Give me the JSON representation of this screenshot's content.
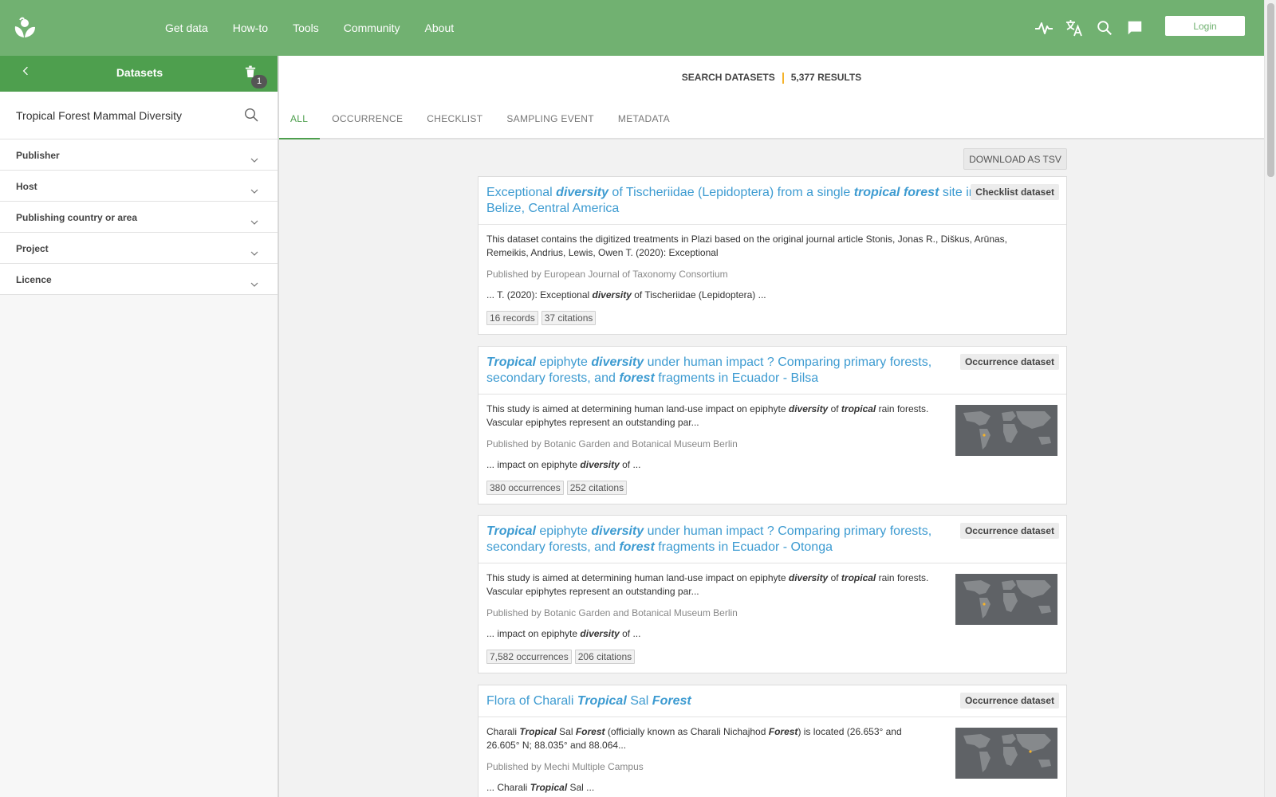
{
  "nav": {
    "items": [
      "Get data",
      "How-to",
      "Tools",
      "Community",
      "About"
    ],
    "login": "Login",
    "icons": [
      "activity-icon",
      "translate-icon",
      "search-icon",
      "feedback-icon"
    ]
  },
  "sidebar": {
    "title": "Datasets",
    "filter_count": "1",
    "search_value": "Tropical Forest Mammal Diversity",
    "facets": [
      "Publisher",
      "Host",
      "Publishing country or area",
      "Project",
      "Licence"
    ]
  },
  "summary": {
    "label": "SEARCH DATASETS",
    "results": "5,377 RESULTS"
  },
  "tabs": [
    "ALL",
    "OCCURRENCE",
    "CHECKLIST",
    "SAMPLING EVENT",
    "METADATA"
  ],
  "download_label": "DOWNLOAD AS TSV",
  "results": [
    {
      "type": "Checklist dataset",
      "title": [
        {
          "t": "Exceptional "
        },
        {
          "t": "diversity",
          "em": true
        },
        {
          "t": " of Tischeriidae (Lepidoptera) from a single "
        },
        {
          "t": "tropical",
          "em": true
        },
        {
          "t": " "
        },
        {
          "t": "forest",
          "em": true
        },
        {
          "t": " site in Belize, Central America"
        }
      ],
      "description": [
        {
          "t": "This dataset contains the digitized treatments in Plazi based on the original journal article Stonis, Jonas R., Diškus, Arūnas, Remeikis, Andrius, Lewis, Owen T. (2020): Exceptional"
        }
      ],
      "publisher": "Published by European Journal of Taxonomy Consortium",
      "highlight": [
        {
          "t": "... T. (2020): Exceptional "
        },
        {
          "t": "diversity",
          "em": true
        },
        {
          "t": " of Tischeriidae (Lepidoptera) ..."
        }
      ],
      "badges": [
        "16 records",
        "37 citations"
      ]
    },
    {
      "type": "Occurrence dataset",
      "title": [
        {
          "t": "Tropical",
          "em": true
        },
        {
          "t": " epiphyte "
        },
        {
          "t": "diversity",
          "em": true
        },
        {
          "t": " under human impact ? Comparing primary forests, secondary forests, and "
        },
        {
          "t": "forest",
          "em": true
        },
        {
          "t": " fragments in Ecuador - Bilsa"
        }
      ],
      "description": [
        {
          "t": "This study is aimed at determining human land-use impact on epiphyte "
        },
        {
          "t": "diversity",
          "em": true
        },
        {
          "t": " of "
        },
        {
          "t": "tropical",
          "em": true
        },
        {
          "t": " rain forests. Vascular epiphytes represent an outstanding par..."
        }
      ],
      "publisher": "Published by Botanic Garden and Botanical Museum Berlin",
      "highlight": [
        {
          "t": "... impact on epiphyte "
        },
        {
          "t": "diversity",
          "em": true
        },
        {
          "t": " of ..."
        }
      ],
      "badges": [
        "380 occurrences",
        "252 citations"
      ],
      "map_region": "south-america-west"
    },
    {
      "type": "Occurrence dataset",
      "title": [
        {
          "t": "Tropical",
          "em": true
        },
        {
          "t": " epiphyte "
        },
        {
          "t": "diversity",
          "em": true
        },
        {
          "t": " under human impact ? Comparing primary forests, secondary forests, and "
        },
        {
          "t": "forest",
          "em": true
        },
        {
          "t": " fragments in Ecuador - Otonga"
        }
      ],
      "description": [
        {
          "t": "This study is aimed at determining human land-use impact on epiphyte "
        },
        {
          "t": "diversity",
          "em": true
        },
        {
          "t": " of "
        },
        {
          "t": "tropical",
          "em": true
        },
        {
          "t": " rain forests. Vascular epiphytes represent an outstanding par..."
        }
      ],
      "publisher": "Published by Botanic Garden and Botanical Museum Berlin",
      "highlight": [
        {
          "t": "... impact on epiphyte "
        },
        {
          "t": "diversity",
          "em": true
        },
        {
          "t": " of ..."
        }
      ],
      "badges": [
        "7,582 occurrences",
        "206 citations"
      ],
      "map_region": "south-america-west"
    },
    {
      "type": "Occurrence dataset",
      "title": [
        {
          "t": "Flora of Charali "
        },
        {
          "t": "Tropical",
          "em": true
        },
        {
          "t": " Sal "
        },
        {
          "t": "Forest",
          "em": true
        }
      ],
      "description": [
        {
          "t": "Charali "
        },
        {
          "t": "Tropical",
          "em": true
        },
        {
          "t": " Sal "
        },
        {
          "t": "Forest",
          "em": true
        },
        {
          "t": " (officially known as Charali Nichajhod "
        },
        {
          "t": "Forest",
          "em": true
        },
        {
          "t": ") is located (26.653° and 26.605° N; 88.035° and 88.064..."
        }
      ],
      "publisher": "Published by Mechi Multiple Campus",
      "highlight": [
        {
          "t": "... Charali "
        },
        {
          "t": "Tropical",
          "em": true
        },
        {
          "t": " Sal ..."
        }
      ],
      "badges": [],
      "map_region": "south-asia"
    }
  ],
  "colors": {
    "topbar": "#71b171",
    "sidebar_header": "#4e9f4e",
    "link": "#3d9bd1",
    "accent_separator": "#f5b32a",
    "map_point": "#f5b32a"
  }
}
